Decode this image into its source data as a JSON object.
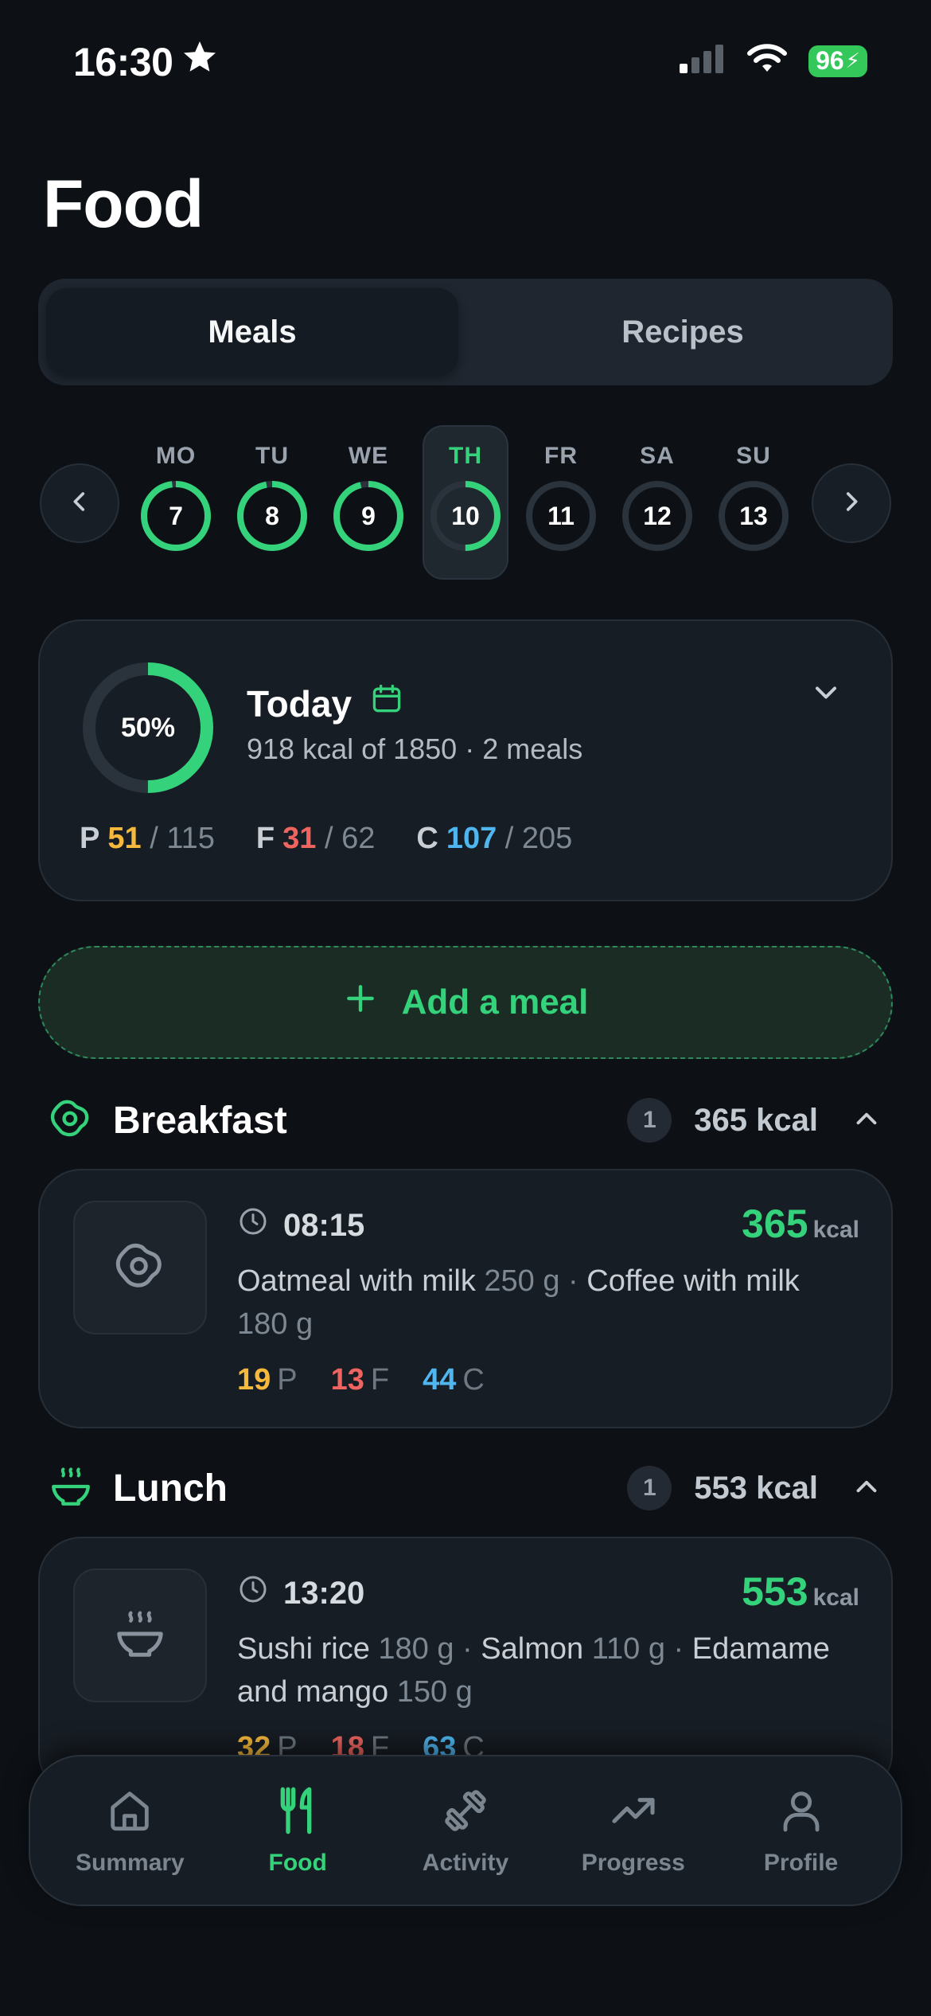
{
  "status": {
    "time": "16:30",
    "battery": "96"
  },
  "page": {
    "title": "Food"
  },
  "segments": {
    "meals": "Meals",
    "recipes": "Recipes"
  },
  "week": {
    "days": [
      {
        "label": "MO",
        "num": "7",
        "progress": 0.98
      },
      {
        "label": "TU",
        "num": "8",
        "progress": 0.97
      },
      {
        "label": "WE",
        "num": "9",
        "progress": 0.96
      },
      {
        "label": "TH",
        "num": "10",
        "progress": 0.5,
        "selected": true
      },
      {
        "label": "FR",
        "num": "11",
        "progress": 0
      },
      {
        "label": "SA",
        "num": "12",
        "progress": 0
      },
      {
        "label": "SU",
        "num": "13",
        "progress": 0
      }
    ]
  },
  "summary": {
    "percent": "50%",
    "progress": 0.5,
    "title": "Today",
    "subtitle": "918 kcal of 1850 · 2 meals",
    "macros": {
      "p": {
        "label": "P",
        "value": "51",
        "target": "/ 115"
      },
      "f": {
        "label": "F",
        "value": "31",
        "target": "/ 62"
      },
      "c": {
        "label": "C",
        "value": "107",
        "target": "/ 205"
      }
    }
  },
  "add_meal": {
    "label": "Add a meal"
  },
  "breakfast": {
    "title": "Breakfast",
    "count": "1",
    "kcal": "365 kcal",
    "item": {
      "time": "08:15",
      "kcal": "365",
      "unit": "kcal",
      "food1": "Oatmeal with milk",
      "food1_g": "250 g",
      "sep1": " · ",
      "food2": "Coffee with milk",
      "food2_g": "180 g",
      "p": "19",
      "p_u": "P",
      "f": "13",
      "f_u": "F",
      "c": "44",
      "c_u": "C"
    }
  },
  "lunch": {
    "title": "Lunch",
    "count": "1",
    "kcal": "553 kcal",
    "item": {
      "time": "13:20",
      "kcal": "553",
      "unit": "kcal",
      "food1": "Sushi rice",
      "food1_g": "180 g",
      "sep1": " · ",
      "food2": "Salmon",
      "food2_g": "110 g",
      "sep2": " · ",
      "food3": "Edamame and mango",
      "food3_g": "150 g",
      "p": "32",
      "p_u": "P",
      "f": "18",
      "f_u": "F",
      "c": "63",
      "c_u": "C"
    }
  },
  "tabs": {
    "summary": "Summary",
    "food": "Food",
    "activity": "Activity",
    "progress": "Progress",
    "profile": "Profile"
  },
  "colors": {
    "accent": "#34d27a",
    "protein": "#f6b93b",
    "fat": "#f0645f",
    "carbs": "#4fb6f0",
    "track": "#2a323b"
  }
}
